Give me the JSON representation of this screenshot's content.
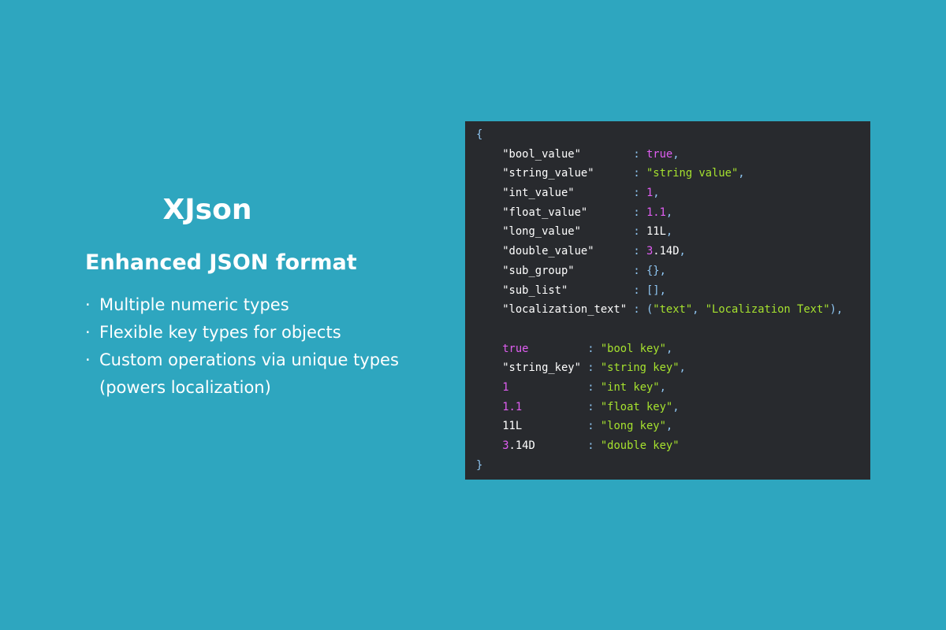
{
  "title": "XJson",
  "subtitle": "Enhanced JSON format",
  "features": [
    {
      "bullet": "·",
      "text": "Multiple numeric types"
    },
    {
      "bullet": "·",
      "text": "Flexible key types for objects"
    },
    {
      "bullet": "·",
      "text": "Custom operations via unique types\n(powers localization)"
    }
  ],
  "colors": {
    "background": "#2ea6bf",
    "code_background": "#282a2e",
    "string": "#a6e22e",
    "keyword_number": "#e05ef2",
    "punctuation": "#8fc6f2",
    "plain": "#ffffff"
  },
  "code_lines": [
    [
      {
        "t": "{",
        "c": "punc"
      }
    ],
    [
      {
        "t": "    \"bool_value\"        ",
        "c": "key"
      },
      {
        "t": ": ",
        "c": "punc"
      },
      {
        "t": "true",
        "c": "kw"
      },
      {
        "t": ",",
        "c": "punc"
      }
    ],
    [
      {
        "t": "    \"string_value\"      ",
        "c": "key"
      },
      {
        "t": ": ",
        "c": "punc"
      },
      {
        "t": "\"string value\"",
        "c": "str"
      },
      {
        "t": ",",
        "c": "punc"
      }
    ],
    [
      {
        "t": "    \"int_value\"         ",
        "c": "key"
      },
      {
        "t": ": ",
        "c": "punc"
      },
      {
        "t": "1",
        "c": "num"
      },
      {
        "t": ",",
        "c": "punc"
      }
    ],
    [
      {
        "t": "    \"float_value\"       ",
        "c": "key"
      },
      {
        "t": ": ",
        "c": "punc"
      },
      {
        "t": "1.1",
        "c": "num"
      },
      {
        "t": ",",
        "c": "punc"
      }
    ],
    [
      {
        "t": "    \"long_value\"        ",
        "c": "key"
      },
      {
        "t": ": ",
        "c": "punc"
      },
      {
        "t": "11L",
        "c": "plain"
      },
      {
        "t": ",",
        "c": "punc"
      }
    ],
    [
      {
        "t": "    \"double_value\"      ",
        "c": "key"
      },
      {
        "t": ": ",
        "c": "punc"
      },
      {
        "t": "3",
        "c": "num"
      },
      {
        "t": ".14D",
        "c": "plain"
      },
      {
        "t": ",",
        "c": "punc"
      }
    ],
    [
      {
        "t": "    \"sub_group\"         ",
        "c": "key"
      },
      {
        "t": ": {},",
        "c": "punc"
      }
    ],
    [
      {
        "t": "    \"sub_list\"          ",
        "c": "key"
      },
      {
        "t": ": [],",
        "c": "punc"
      }
    ],
    [
      {
        "t": "    \"localization_text\" ",
        "c": "key"
      },
      {
        "t": ": (",
        "c": "punc"
      },
      {
        "t": "\"text\"",
        "c": "str"
      },
      {
        "t": ", ",
        "c": "punc"
      },
      {
        "t": "\"Localization Text\"",
        "c": "str"
      },
      {
        "t": "),",
        "c": "punc"
      }
    ],
    [],
    [
      {
        "t": "    ",
        "c": "plain"
      },
      {
        "t": "true",
        "c": "kw"
      },
      {
        "t": "         ",
        "c": "plain"
      },
      {
        "t": ": ",
        "c": "punc"
      },
      {
        "t": "\"bool key\"",
        "c": "str"
      },
      {
        "t": ",",
        "c": "punc"
      }
    ],
    [
      {
        "t": "    \"string_key\" ",
        "c": "key"
      },
      {
        "t": ": ",
        "c": "punc"
      },
      {
        "t": "\"string key\"",
        "c": "str"
      },
      {
        "t": ",",
        "c": "punc"
      }
    ],
    [
      {
        "t": "    ",
        "c": "plain"
      },
      {
        "t": "1",
        "c": "num"
      },
      {
        "t": "            ",
        "c": "plain"
      },
      {
        "t": ": ",
        "c": "punc"
      },
      {
        "t": "\"int key\"",
        "c": "str"
      },
      {
        "t": ",",
        "c": "punc"
      }
    ],
    [
      {
        "t": "    ",
        "c": "plain"
      },
      {
        "t": "1.1",
        "c": "num"
      },
      {
        "t": "          ",
        "c": "plain"
      },
      {
        "t": ": ",
        "c": "punc"
      },
      {
        "t": "\"float key\"",
        "c": "str"
      },
      {
        "t": ",",
        "c": "punc"
      }
    ],
    [
      {
        "t": "    11L          ",
        "c": "plain"
      },
      {
        "t": ": ",
        "c": "punc"
      },
      {
        "t": "\"long key\"",
        "c": "str"
      },
      {
        "t": ",",
        "c": "punc"
      }
    ],
    [
      {
        "t": "    ",
        "c": "plain"
      },
      {
        "t": "3",
        "c": "num"
      },
      {
        "t": ".14D        ",
        "c": "plain"
      },
      {
        "t": ": ",
        "c": "punc"
      },
      {
        "t": "\"double key\"",
        "c": "str"
      }
    ],
    [
      {
        "t": "}",
        "c": "punc"
      }
    ]
  ]
}
